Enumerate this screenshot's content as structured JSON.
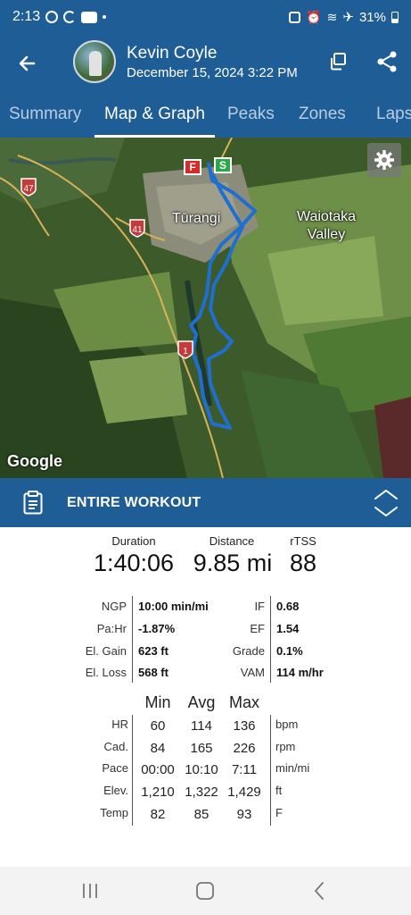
{
  "status_bar": {
    "time": "2:13",
    "battery": "31%"
  },
  "header": {
    "user_name": "Kevin Coyle",
    "date": "December 15, 2024  3:22 PM"
  },
  "tabs": [
    {
      "label": "Summary"
    },
    {
      "label": "Map & Graph"
    },
    {
      "label": "Peaks"
    },
    {
      "label": "Zones"
    },
    {
      "label": "Laps"
    }
  ],
  "map": {
    "labels": [
      "Tūrangi",
      "Waiotaka",
      "Valley"
    ],
    "road_shields": [
      "47",
      "41",
      "1"
    ],
    "finish_marker": "F",
    "start_marker": "S",
    "attribution": "Google",
    "route_color": "#1f6fd0"
  },
  "section": {
    "title": "ENTIRE WORKOUT"
  },
  "summary": {
    "duration": {
      "label": "Duration",
      "value": "1:40:06"
    },
    "distance": {
      "label": "Distance",
      "value": "9.85 mi"
    },
    "rtss": {
      "label": "rTSS",
      "value": "88"
    }
  },
  "metrics": {
    "left": [
      {
        "label": "NGP",
        "value": "10:00 min/mi"
      },
      {
        "label": "Pa:Hr",
        "value": "-1.87%"
      },
      {
        "label": "El. Gain",
        "value": "623 ft"
      },
      {
        "label": "El. Loss",
        "value": "568 ft"
      }
    ],
    "right": [
      {
        "label": "IF",
        "value": "0.68"
      },
      {
        "label": "EF",
        "value": "1.54"
      },
      {
        "label": "Grade",
        "value": "0.1%"
      },
      {
        "label": "VAM",
        "value": "114 m/hr"
      }
    ]
  },
  "stats_table": {
    "headers": [
      "Min",
      "Avg",
      "Max"
    ],
    "rows": [
      {
        "label": "HR",
        "min": "60",
        "avg": "114",
        "max": "136",
        "unit": "bpm"
      },
      {
        "label": "Cad.",
        "min": "84",
        "avg": "165",
        "max": "226",
        "unit": "rpm"
      },
      {
        "label": "Pace",
        "min": "00:00",
        "avg": "10:10",
        "max": "7:11",
        "unit": "min/mi"
      },
      {
        "label": "Elev.",
        "min": "1,210",
        "avg": "1,322",
        "max": "1,429",
        "unit": "ft"
      },
      {
        "label": "Temp",
        "min": "82",
        "avg": "85",
        "max": "93",
        "unit": "F"
      }
    ]
  },
  "colors": {
    "brand": "#1f5d96",
    "route": "#1f6fd0"
  }
}
